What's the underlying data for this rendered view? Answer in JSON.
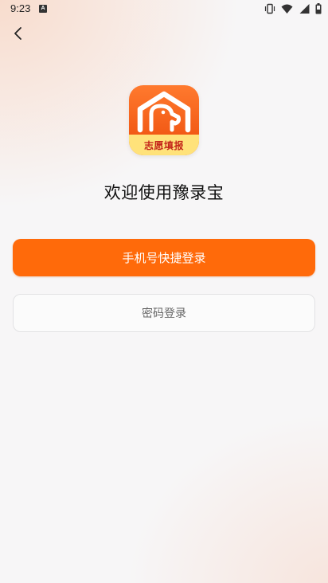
{
  "status_bar": {
    "time": "9:23",
    "notification_badge": "A",
    "icons": [
      "vibrate-icon",
      "wifi-icon",
      "signal-icon",
      "battery-icon"
    ]
  },
  "app": {
    "logo_text": "志愿填报",
    "welcome": "欢迎使用豫录宝"
  },
  "buttons": {
    "phone_login": "手机号快捷登录",
    "password_login": "密码登录"
  },
  "colors": {
    "primary": "#ff6a0a",
    "logo_band": "#ffe27a",
    "logo_text": "#c4251a"
  }
}
